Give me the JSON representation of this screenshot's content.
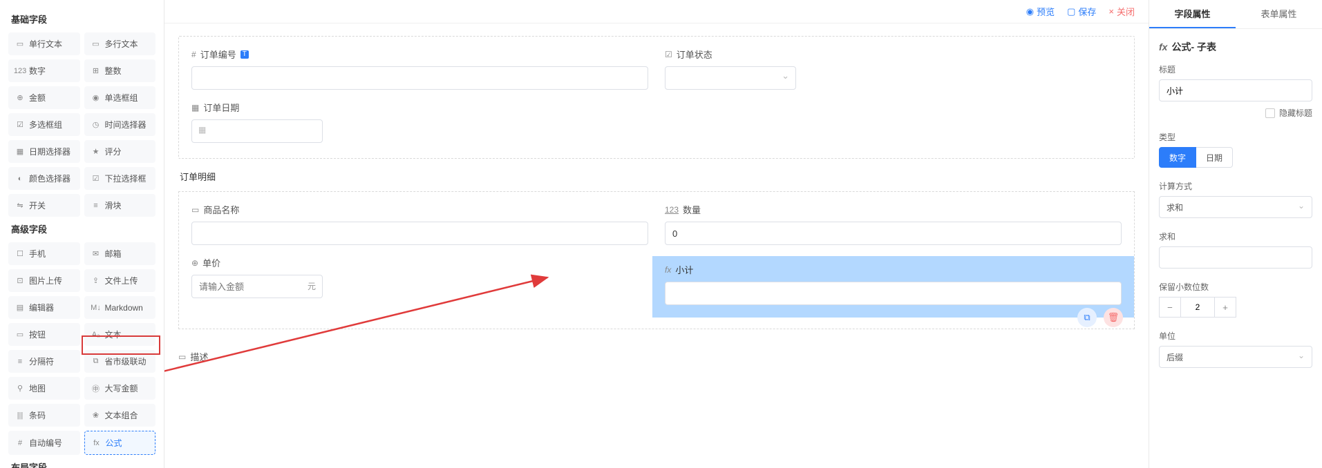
{
  "palette": {
    "group_basic": "基础字段",
    "group_advanced": "高级字段",
    "group_layout": "布局字段",
    "basic": [
      {
        "icon": "▭",
        "label": "单行文本"
      },
      {
        "icon": "▭",
        "label": "多行文本"
      },
      {
        "icon": "123",
        "label": "数字"
      },
      {
        "icon": "⊞",
        "label": "整数"
      },
      {
        "icon": "⊕",
        "label": "金额"
      },
      {
        "icon": "◉",
        "label": "单选框组"
      },
      {
        "icon": "☑",
        "label": "多选框组"
      },
      {
        "icon": "◷",
        "label": "时间选择器"
      },
      {
        "icon": "▦",
        "label": "日期选择器"
      },
      {
        "icon": "★",
        "label": "评分"
      },
      {
        "icon": "◐",
        "label": "颜色选择器"
      },
      {
        "icon": "☑",
        "label": "下拉选择框"
      },
      {
        "icon": "⇋",
        "label": "开关"
      },
      {
        "icon": "≡",
        "label": "滑块"
      }
    ],
    "advanced": [
      {
        "icon": "☐",
        "label": "手机"
      },
      {
        "icon": "✉",
        "label": "邮箱"
      },
      {
        "icon": "⊡",
        "label": "图片上传"
      },
      {
        "icon": "⇪",
        "label": "文件上传"
      },
      {
        "icon": "▤",
        "label": "编辑器"
      },
      {
        "icon": "M↓",
        "label": "Markdown"
      },
      {
        "icon": "▭",
        "label": "按钮"
      },
      {
        "icon": "Aₐ",
        "label": "文本"
      },
      {
        "icon": "≡",
        "label": "分隔符"
      },
      {
        "icon": "⧉",
        "label": "省市级联动"
      },
      {
        "icon": "⚲",
        "label": "地图"
      },
      {
        "icon": "㊥",
        "label": "大写金额"
      },
      {
        "icon": "|||",
        "label": "条码"
      },
      {
        "icon": "❀",
        "label": "文本组合"
      },
      {
        "icon": "#",
        "label": "自动编号"
      },
      {
        "icon": "fx",
        "label": "公式",
        "dragged": true
      }
    ]
  },
  "toolbar": {
    "preview": "预览",
    "save": "保存",
    "close": "关闭"
  },
  "canvas": {
    "top": {
      "order_no": {
        "label": "订单编号",
        "badge": "T"
      },
      "order_status": {
        "label": "订单状态"
      },
      "order_date": {
        "label": "订单日期"
      }
    },
    "detail_title": "订单明细",
    "detail": {
      "product_name": {
        "label": "商品名称"
      },
      "qty": {
        "label": "数量",
        "value": "0"
      },
      "price": {
        "label": "单价",
        "placeholder": "请输入金额",
        "unit": "元"
      },
      "subtotal": {
        "label": "小计"
      }
    },
    "desc_label": "描述"
  },
  "props": {
    "tab_field": "字段属性",
    "tab_form": "表单属性",
    "head_prefix": "fx",
    "head": "公式- 子表",
    "title_label": "标题",
    "title_value": "小计",
    "hide_title": "隐藏标题",
    "type_label": "类型",
    "type_num": "数字",
    "type_date": "日期",
    "calc_label": "计算方式",
    "calc_value": "求和",
    "sum_label": "求和",
    "decimal_label": "保留小数位数",
    "decimal_value": "2",
    "unit_label": "单位",
    "unit_value": "后缀"
  }
}
